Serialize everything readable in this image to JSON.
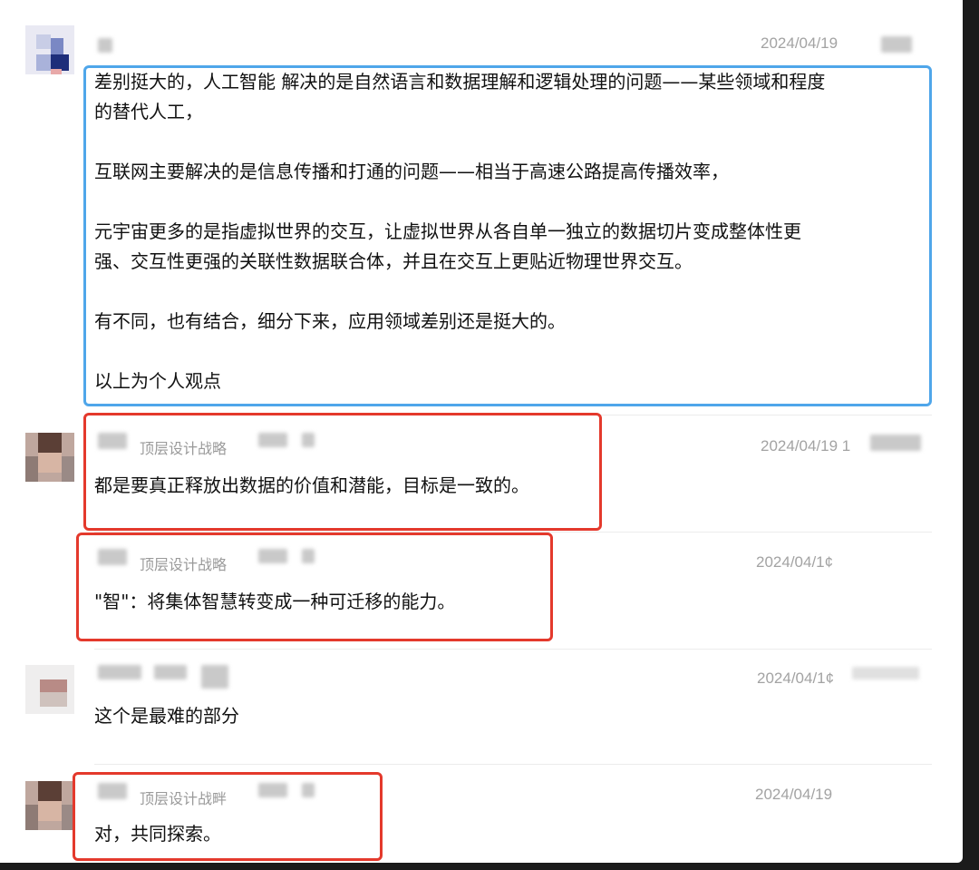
{
  "messages": [
    {
      "time": "2024/04/19",
      "text": "差别挺大的，人工智能 解决的是自然语言和数据理解和逻辑处理的问题——某些领域和程度\n的替代人工，\n\n互联网主要解决的是信息传播和打通的问题——相当于高速公路提高传播效率，\n\n元宇宙更多的是指虚拟世界的交互，让虚拟世界从各自单一独立的数据切片变成整体性更\n强、交互性更强的关联性数据联合体，并且在交互上更贴近物理世界交互。\n\n有不同，也有结合，细分下来，应用领域差别还是挺大的。\n\n以上为个人观点"
    },
    {
      "group": "顶层设计战略",
      "time": "2024/04/19 1",
      "text": "都是要真正释放出数据的价值和潜能，目标是一致的。"
    },
    {
      "group": "顶层设计战略",
      "time": "2024/04/1¢",
      "text": "\"智\"：将集体智慧转变成一种可迁移的能力。"
    },
    {
      "time": "2024/04/1¢",
      "text": "这个是最难的部分"
    },
    {
      "group": "顶层设计战畔",
      "time": "2024/04/19",
      "text": "对，共同探索。"
    }
  ],
  "highlight_colors": {
    "blue": "#4fa6ea",
    "red": "#e4392c"
  }
}
